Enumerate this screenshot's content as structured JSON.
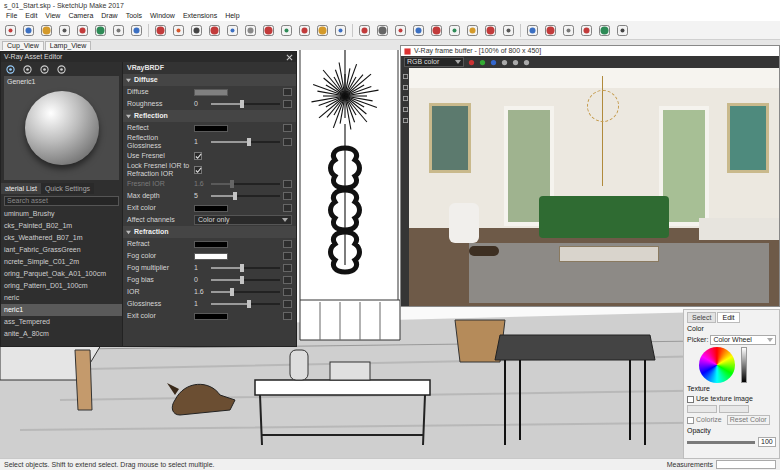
{
  "window": {
    "title": "s_01_Start.skp - SketchUp Make 2017"
  },
  "menu": [
    "File",
    "Edit",
    "View",
    "Camera",
    "Draw",
    "Tools",
    "Window",
    "Extensions",
    "Help"
  ],
  "scene_tabs": [
    "Cup_View",
    "Lamp_View"
  ],
  "asset_editor": {
    "title": "V-Ray Asset Editor",
    "preview_name": "Generic1",
    "tabs": [
      {
        "label": "aterial List",
        "selected": true
      },
      {
        "label": "Quick Settings",
        "selected": false
      }
    ],
    "search_placeholder": "Search asset",
    "materials": [
      {
        "label": "uminum_Brushy",
        "selected": false
      },
      {
        "label": "cks_Painted_B02_1m",
        "selected": false
      },
      {
        "label": "cks_Weathered_B07_1m",
        "selected": false
      },
      {
        "label": "iant_Fabric_GrassGreen",
        "selected": false
      },
      {
        "label": "ncrete_Simple_C01_2m",
        "selected": false
      },
      {
        "label": "oring_Parquet_Oak_A01_100cm",
        "selected": false
      },
      {
        "label": "oring_Pattern_D01_100cm",
        "selected": false
      },
      {
        "label": "neric",
        "selected": false
      },
      {
        "label": "neric1",
        "selected": true
      },
      {
        "label": "ass_Tempered",
        "selected": false
      },
      {
        "label": "anite_A_80cm",
        "selected": false
      }
    ],
    "brdf_title": "VRayBRDF",
    "sections": [
      {
        "title": "Diffuse",
        "expanded": true,
        "rows": [
          {
            "label": "Diffuse",
            "kind": "color",
            "color": "#808080",
            "disabled": false
          },
          {
            "label": "Roughness",
            "kind": "slider",
            "value": "0",
            "level": 0.45,
            "disabled": false
          }
        ]
      },
      {
        "title": "Reflection",
        "expanded": true,
        "rows": [
          {
            "label": "Reflect",
            "kind": "color",
            "color": "#000000",
            "disabled": false
          },
          {
            "label": "Reflection Glossiness",
            "kind": "slider",
            "value": "1",
            "level": 0.55,
            "disabled": false
          },
          {
            "label": "Use Fresnel",
            "kind": "checkbox",
            "checked": true,
            "disabled": false
          },
          {
            "label": "Lock Fresnel IOR to Refraction IOR",
            "kind": "checkbox",
            "checked": true,
            "disabled": false
          },
          {
            "label": "Fresnel IOR",
            "kind": "slider",
            "value": "1.6",
            "level": 0.3,
            "disabled": true
          },
          {
            "label": "Max depth",
            "kind": "slider",
            "value": "5",
            "level": 0.35,
            "disabled": false
          },
          {
            "label": "Exit color",
            "kind": "color",
            "color": "#000000",
            "disabled": false
          },
          {
            "label": "Affect channels",
            "kind": "dropdown",
            "value": "Color only",
            "disabled": false
          }
        ]
      },
      {
        "title": "Refraction",
        "expanded": true,
        "rows": [
          {
            "label": "Refract",
            "kind": "color",
            "color": "#000000",
            "disabled": false
          },
          {
            "label": "Fog color",
            "kind": "color",
            "color": "#ffffff",
            "disabled": false
          },
          {
            "label": "Fog multiplier",
            "kind": "slider",
            "value": "1",
            "level": 0.45,
            "disabled": false
          },
          {
            "label": "Fog bias",
            "kind": "slider",
            "value": "0",
            "level": 0.45,
            "disabled": false
          },
          {
            "label": "IOR",
            "kind": "slider",
            "value": "1.6",
            "level": 0.3,
            "disabled": false
          },
          {
            "label": "Glossiness",
            "kind": "slider",
            "value": "1",
            "level": 0.55,
            "disabled": false
          },
          {
            "label": "Exit color",
            "kind": "color",
            "color": "#000000",
            "disabled": false
          }
        ]
      }
    ]
  },
  "frame_buffer": {
    "title": "V-Ray frame buffer - [100% of 800 x 450]",
    "channel": "RGB color"
  },
  "materials_tray": {
    "tabs": [
      {
        "label": "Select",
        "selected": false
      },
      {
        "label": "Edit",
        "selected": true
      }
    ],
    "color_label": "Color",
    "picker_label": "Picker:",
    "picker_value": "Color Wheel",
    "texture_label": "Texture",
    "use_texture": {
      "label": "Use texture image",
      "checked": false
    },
    "colorize": {
      "label": "Colorize",
      "checked": false
    },
    "reset": "Reset Color",
    "opacity_label": "Opacity",
    "opacity_value": "100",
    "opacity_level": 1
  },
  "status_bar": {
    "hint": "Select objects. Shift to extend select. Drag mouse to select multiple.",
    "measurements": "Measurements"
  }
}
